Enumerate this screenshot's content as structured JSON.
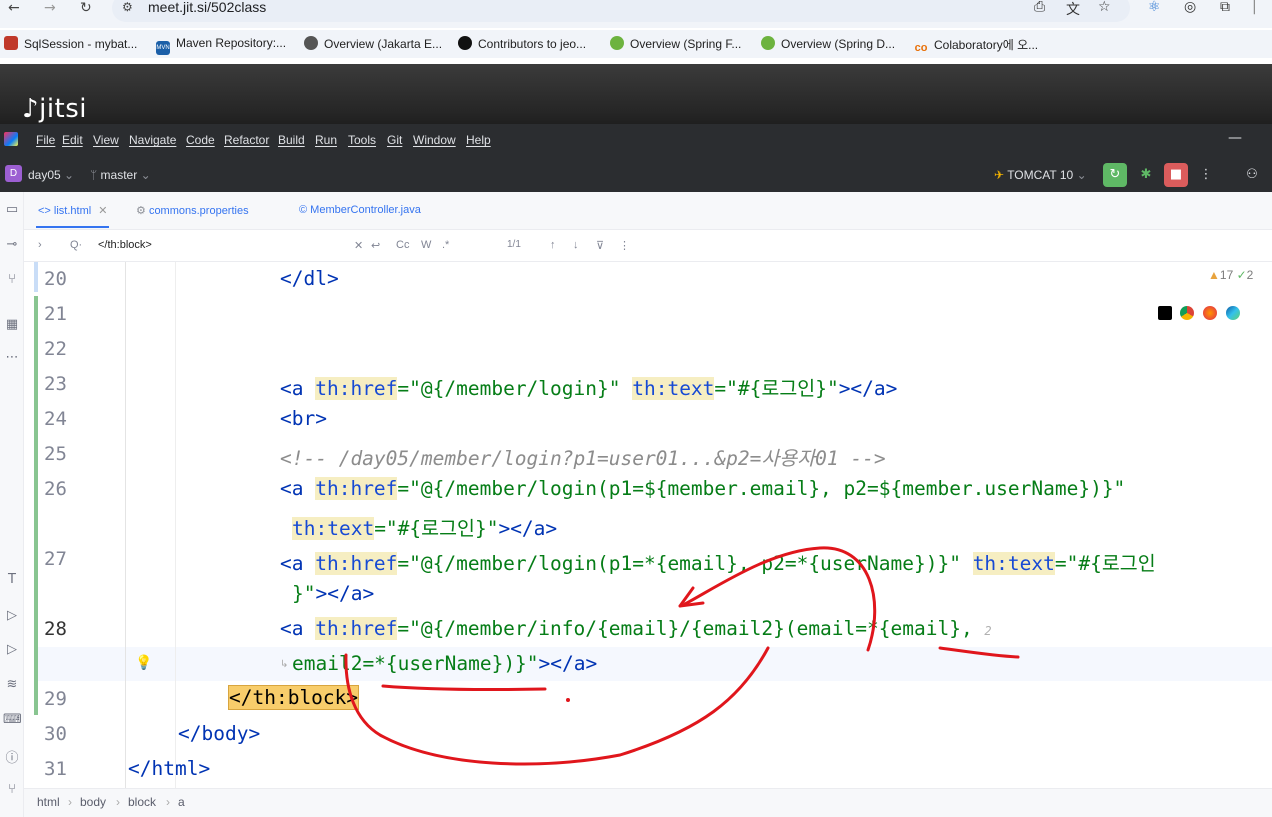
{
  "browser": {
    "url": "meet.jit.si/502class",
    "bookmarks": [
      {
        "label": "SqlSession - mybat...",
        "icon": "mybatis-icon",
        "color": "#c0392b"
      },
      {
        "label": "Maven Repository:...",
        "icon": "maven-icon",
        "color": "#1b5fa8"
      },
      {
        "label": "Overview (Jakarta E...",
        "icon": "globe-icon",
        "color": "#555555"
      },
      {
        "label": "Contributors to jeo...",
        "icon": "github-icon",
        "color": "#111111"
      },
      {
        "label": "Overview (Spring F...",
        "icon": "spring-icon",
        "color": "#6db33f"
      },
      {
        "label": "Overview (Spring D...",
        "icon": "spring-icon",
        "color": "#6db33f"
      },
      {
        "label": "Colaboratory에 오...",
        "icon": "colab-icon",
        "color": "#f9ab00"
      }
    ]
  },
  "jitsi": {
    "logo": "jitsi"
  },
  "ide": {
    "menu": [
      "File",
      "Edit",
      "View",
      "Navigate",
      "Code",
      "Refactor",
      "Build",
      "Run",
      "Tools",
      "Git",
      "Window",
      "Help"
    ],
    "project_badge": "D",
    "project": "day05",
    "branch": "master",
    "run_config": "TOMCAT 10",
    "tabs": [
      {
        "label": "list.html",
        "icon": "html-icon",
        "active": true
      },
      {
        "label": "commons.properties",
        "icon": "properties-icon",
        "active": false
      },
      {
        "label": "MemberController.java",
        "icon": "java-class-icon",
        "active": false
      }
    ],
    "search": {
      "query": "</th:block>",
      "options": [
        "Cc",
        "W",
        ".*"
      ],
      "count": "1/1"
    },
    "inspections": {
      "warnings": "17",
      "checks": "2"
    }
  },
  "editor": {
    "line_numbers": [
      "20",
      "21",
      "22",
      "23",
      "24",
      "25",
      "26",
      "",
      "27",
      "",
      "28",
      "",
      "29",
      "30",
      "31"
    ],
    "lines": {
      "l20": "</dl>",
      "l23a": "<a ",
      "l23b": "th:href",
      "l23c": "=\"@{/member/login}\" ",
      "l23d": "th:text",
      "l23e": "=\"#{로그인}\"",
      "l23f": "></a>",
      "l24": "<br>",
      "l25": "<!-- /day05/member/login?p1=user01...&p2=사용자01 -->",
      "l26a": "<a ",
      "l26b": "th:href",
      "l26c": "=\"@{/member/login(p1=${member.email}, p2=${member.userName})}\"",
      "l26d": "th:text",
      "l26e": "=\"#{로그인}\"",
      "l26f": "></a>",
      "l27a": "<a ",
      "l27b": "th:href",
      "l27c": "=\"@{/member/login(p1=*{email}, p2=*{userName})}\" ",
      "l27d": "th:text",
      "l27e": "=\"#{로그인",
      "l27f": "}\"",
      "l27g": "></a>",
      "l28a": "<a ",
      "l28b": "th:href",
      "l28c": "=\"@{/member/info/{email}/{email2}(email=*{email}, ",
      "l28d": "email2=*{userName})}\"",
      "l28e": "></a>",
      "l28hint": "2",
      "l29": "</th:block>",
      "l30": "</body>",
      "l31": "</html>"
    }
  },
  "breadcrumbs": [
    "html",
    "body",
    "block",
    "a"
  ]
}
